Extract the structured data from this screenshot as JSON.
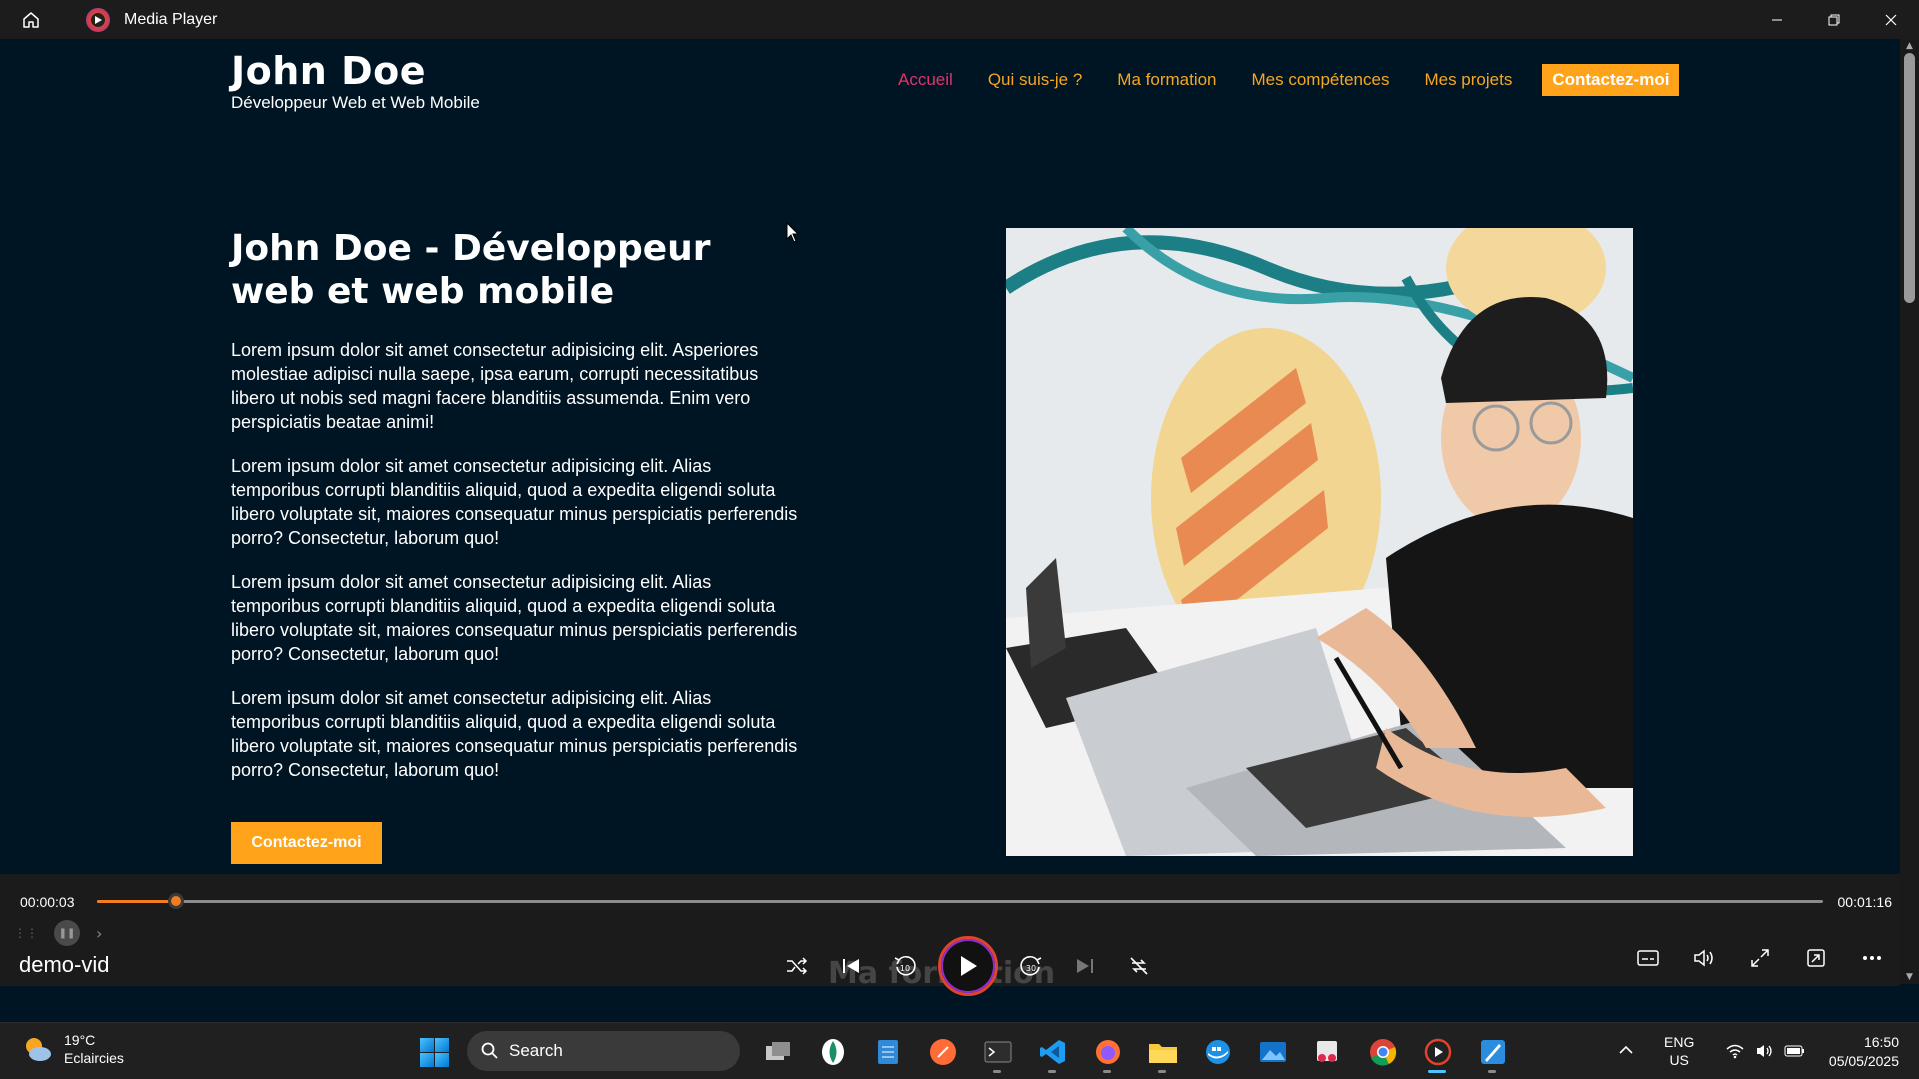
{
  "window": {
    "title": "Media Player"
  },
  "website": {
    "brand_name": "John Doe",
    "brand_role": "Développeur Web et Web Mobile",
    "nav": [
      {
        "label": "Accueil"
      },
      {
        "label": "Qui suis-je ?"
      },
      {
        "label": "Ma formation"
      },
      {
        "label": "Mes compétences"
      },
      {
        "label": "Mes projets"
      }
    ],
    "nav_cta": "Contactez-moi",
    "hero_title": "John Doe - Développeur web et web mobile",
    "paragraphs": [
      "Lorem ipsum dolor sit amet consectetur adipisicing elit. Asperiores molestiae adipisci nulla saepe, ipsa earum, corrupti necessitatibus libero ut nobis sed magni facere blanditiis assumenda. Enim vero perspiciatis beatae animi!",
      "Lorem ipsum dolor sit amet consectetur adipisicing elit. Alias temporibus corrupti blanditiis aliquid, quod a expedita eligendi soluta libero voluptate sit, maiores consequatur minus perspiciatis perferendis porro? Consectetur, laborum quo!",
      "Lorem ipsum dolor sit amet consectetur adipisicing elit. Alias temporibus corrupti blanditiis aliquid, quod a expedita eligendi soluta libero voluptate sit, maiores consequatur minus perspiciatis perferendis porro? Consectetur, laborum quo!",
      "Lorem ipsum dolor sit amet consectetur adipisicing elit. Alias temporibus corrupti blanditiis aliquid, quod a expedita eligendi soluta libero voluptate sit, maiores consequatur minus perspiciatis perferendis porro? Consectetur, laborum quo!"
    ],
    "hero_cta": "Contactez-moi",
    "colors": {
      "accent": "#ffa31a",
      "active_nav": "#e0336b",
      "background": "#001523"
    }
  },
  "player": {
    "current_time": "00:00:03",
    "total_time": "00:01:16",
    "progress": 0.046,
    "media_name": "demo-vid",
    "ghost_caption": "Ma formation",
    "accent_color": "#f47b20"
  },
  "taskbar": {
    "weather_temp": "19°C",
    "weather_desc": "Eclaircies",
    "search_label": "Search",
    "lang_1": "ENG",
    "lang_2": "US",
    "time": "16:50",
    "date": "05/05/2025",
    "apps": [
      "task-view-icon",
      "notepad-icon",
      "sticky-notes-icon",
      "postman-icon",
      "terminal-icon",
      "vscode-icon",
      "firefox-icon",
      "file-explorer-icon",
      "docker-icon",
      "photos-icon",
      "snipping-tool-icon",
      "chrome-icon",
      "media-player-icon",
      "paint-icon"
    ]
  }
}
